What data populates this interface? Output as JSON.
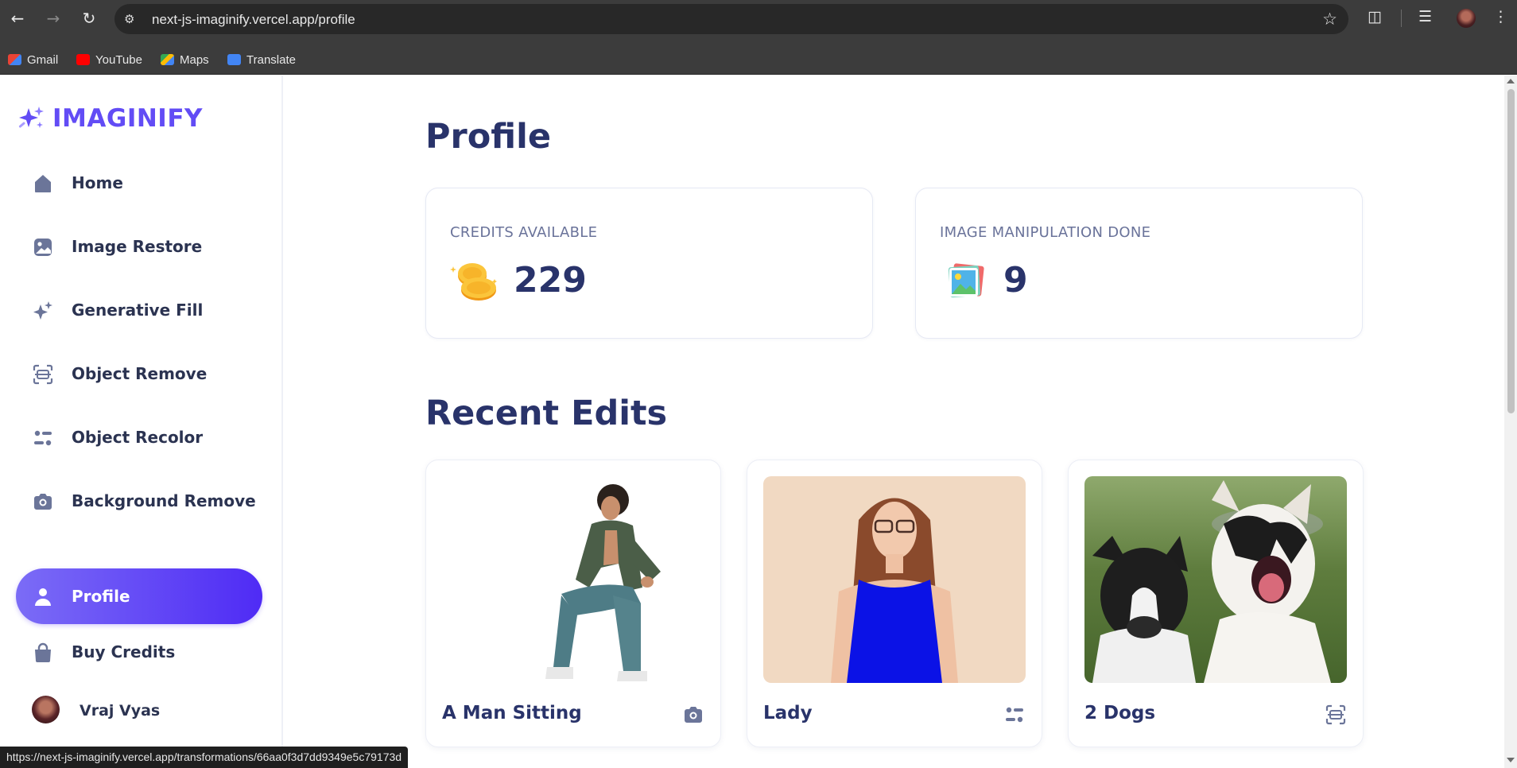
{
  "browser": {
    "url": "next-js-imaginify.vercel.app/profile",
    "bookmarks": [
      "Gmail",
      "YouTube",
      "Maps",
      "Translate"
    ],
    "status_url": "https://next-js-imaginify.vercel.app/transformations/66aa0f3d7dd9349e5c79173d"
  },
  "sidebar": {
    "logo_text": "IMAGINIFY",
    "items": [
      {
        "label": "Home",
        "icon": "home-icon"
      },
      {
        "label": "Image Restore",
        "icon": "image-icon"
      },
      {
        "label": "Generative Fill",
        "icon": "stars-icon"
      },
      {
        "label": "Object Remove",
        "icon": "scan-icon"
      },
      {
        "label": "Object Recolor",
        "icon": "filter-icon"
      },
      {
        "label": "Background Remove",
        "icon": "camera-icon"
      }
    ],
    "secondary": [
      {
        "label": "Profile",
        "icon": "user-icon",
        "active": true
      },
      {
        "label": "Buy Credits",
        "icon": "bag-icon"
      }
    ],
    "user_name": "Vraj Vyas"
  },
  "main": {
    "title": "Profile",
    "stats": [
      {
        "label": "CREDITS AVAILABLE",
        "value": "229",
        "icon": "coins-icon"
      },
      {
        "label": "IMAGE MANIPULATION DONE",
        "value": "9",
        "icon": "photo-icon"
      }
    ],
    "recent_title": "Recent Edits",
    "edits": [
      {
        "title": "A Man Sitting",
        "icon": "camera-icon"
      },
      {
        "title": "Lady",
        "icon": "filter-icon"
      },
      {
        "title": "2 Dogs",
        "icon": "scan-icon"
      }
    ]
  },
  "colors": {
    "brand": "#624cf5",
    "heading": "#29336a",
    "active_start": "#7b6cf6",
    "active_end": "#4f2bf5",
    "chrome": "#3c3c3c"
  }
}
